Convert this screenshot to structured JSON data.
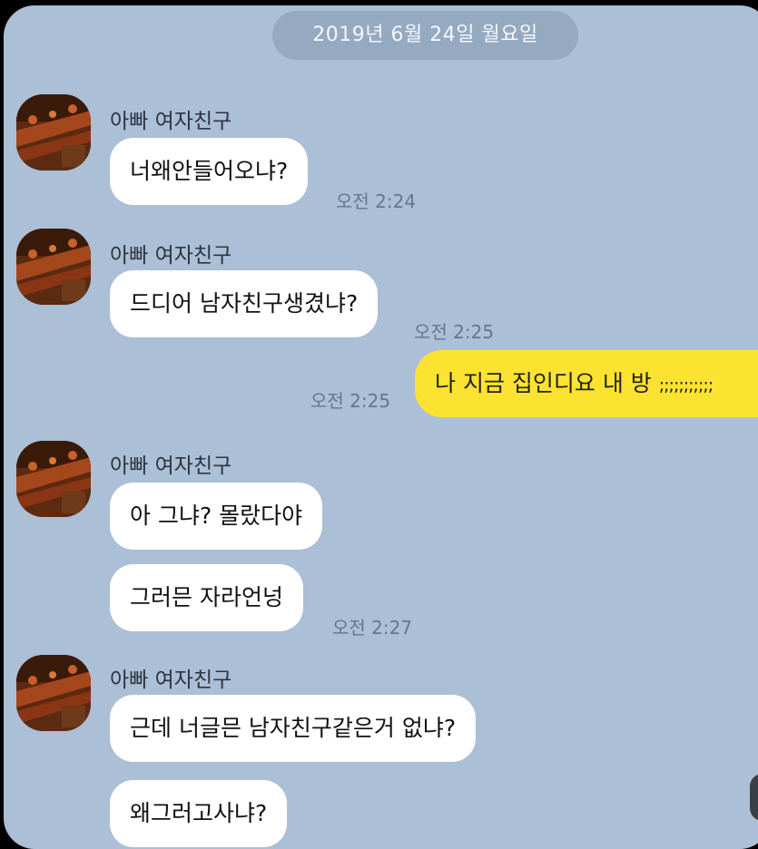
{
  "date_header": "2019년 6월 24일 월요일",
  "groups": [
    {
      "sender": "아빠 여자친구",
      "messages": [
        "너왜안들어오냐?"
      ],
      "time": "오전 2:24"
    },
    {
      "sender": "아빠 여자친구",
      "messages": [
        "드디어 남자친구생겼냐?"
      ],
      "time": "오전 2:25"
    },
    {
      "sender": "아빠 여자친구",
      "messages": [
        "아 그냐? 몰랐다야",
        "그러믄 자라언넝"
      ],
      "time": "오전 2:27"
    },
    {
      "sender": "아빠 여자친구",
      "messages": [
        "근데 너글믄 남자친구같은거 없냐?",
        "왜그러고사냐?"
      ],
      "time": ""
    }
  ],
  "my_message": {
    "text": "나 지금 집인디요 내 방",
    "suffix": ";;;;;;;;;;;",
    "time": "오전 2:25"
  },
  "colors": {
    "chat_background": "#abbfd6",
    "incoming_bubble": "#ffffff",
    "outgoing_bubble": "#fde331",
    "date_pill": "#95a9c1"
  }
}
